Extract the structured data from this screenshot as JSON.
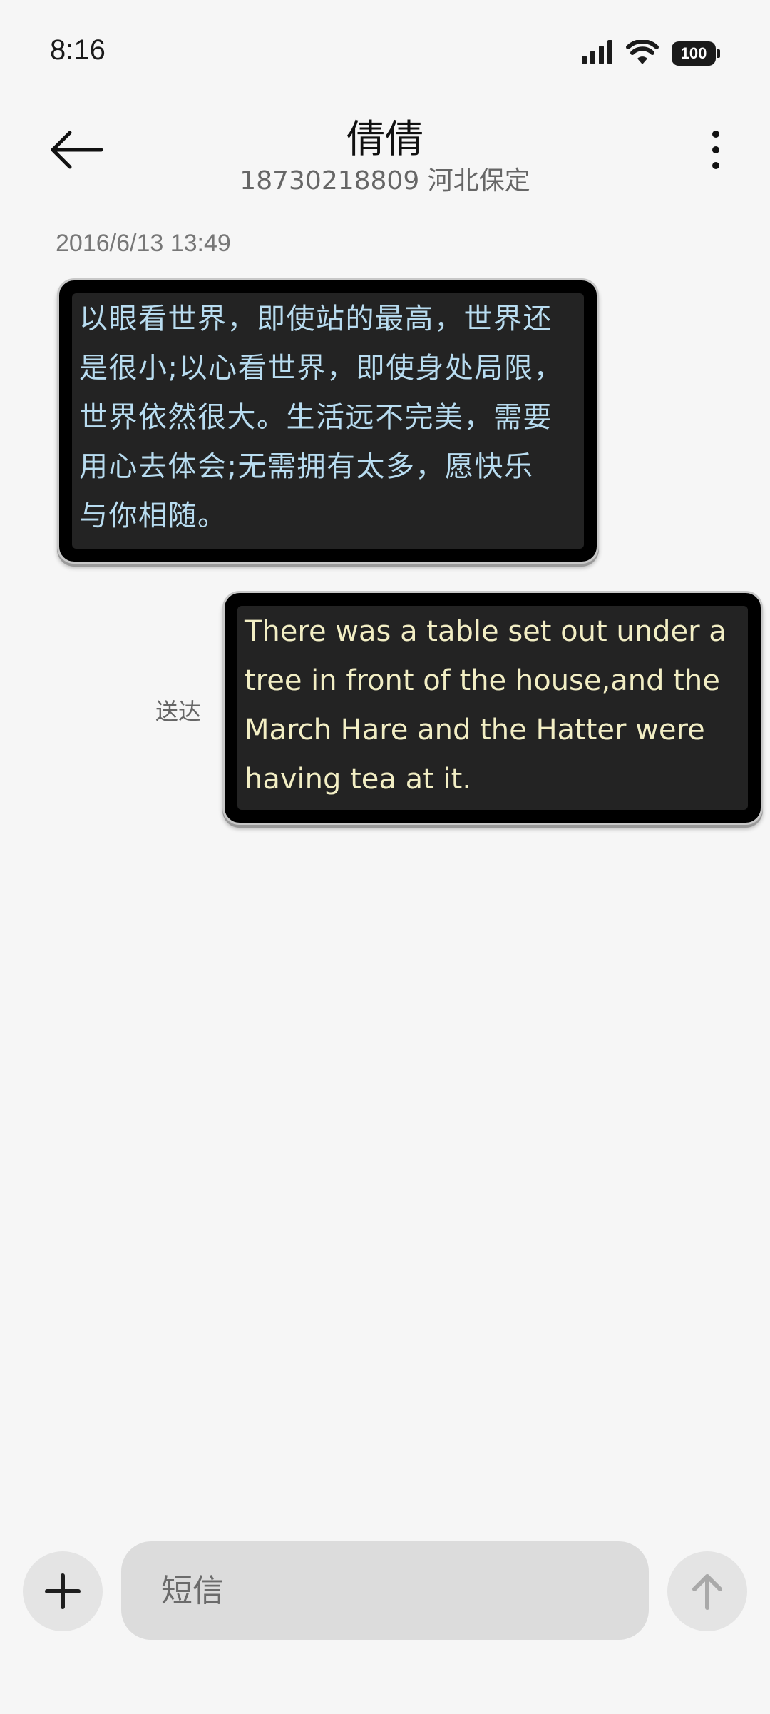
{
  "status_bar": {
    "time": "8:16",
    "battery_level": "100",
    "icons": [
      "signal-icon",
      "wifi-icon",
      "battery-icon"
    ]
  },
  "header": {
    "contact_name": "倩倩",
    "contact_number": "18730218809 河北保定",
    "icons": [
      "back-arrow-icon",
      "more-vertical-icon"
    ]
  },
  "conversation": {
    "timestamp": "2016/6/13 13:49",
    "messages": [
      {
        "direction": "incoming",
        "lines": [
          "以眼看世界，即使站的最高，世界还",
          "是很小;以心看世界，即使身处局限，",
          "世界依然很大。生活远不完美，需要",
          "用心去体会;无需拥有太多，愿快乐",
          "与你相随。"
        ]
      },
      {
        "direction": "outgoing",
        "lines": [
          "There was a table set out under a",
          "tree in front of the house,and the",
          "March Hare and the Hatter were",
          "having tea at it."
        ],
        "status": "送达"
      }
    ]
  },
  "composer": {
    "placeholder": "短信",
    "icons": [
      "plus-icon",
      "send-arrow-up-icon"
    ]
  },
  "colors": {
    "background": "#f6f6f6",
    "bubble_frame": "#000000",
    "bubble_fill": "#232323",
    "incoming_text": "#b8dcf0",
    "outgoing_text": "#f2eec4",
    "input_fill": "#dcdcdc"
  }
}
